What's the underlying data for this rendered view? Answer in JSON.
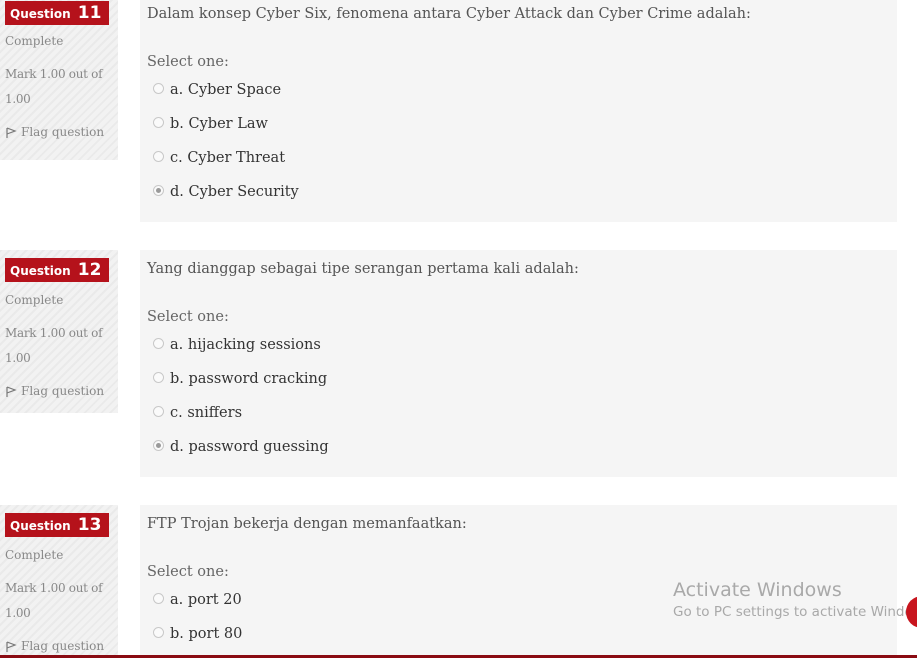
{
  "labels": {
    "question": "Question",
    "select_one": "Select one:"
  },
  "questions": [
    {
      "number": "11",
      "state": "Complete",
      "grade_line1": "Mark 1.00 out of",
      "grade_line2": "1.00",
      "flag": "Flag question",
      "text": "Dalam konsep Cyber Six, fenomena antara Cyber Attack dan Cyber Crime adalah:",
      "options": [
        {
          "label": "a. Cyber Space",
          "selected": false
        },
        {
          "label": "b. Cyber Law",
          "selected": false
        },
        {
          "label": "c. Cyber Threat",
          "selected": false
        },
        {
          "label": "d. Cyber Security",
          "selected": true
        }
      ]
    },
    {
      "number": "12",
      "state": "Complete",
      "grade_line1": "Mark 1.00 out of",
      "grade_line2": "1.00",
      "flag": "Flag question",
      "text": "Yang dianggap sebagai tipe serangan pertama kali adalah:",
      "options": [
        {
          "label": "a. hijacking sessions",
          "selected": false
        },
        {
          "label": "b. password cracking",
          "selected": false
        },
        {
          "label": "c. sniffers",
          "selected": false
        },
        {
          "label": "d. password guessing",
          "selected": true
        }
      ]
    },
    {
      "number": "13",
      "state": "Complete",
      "grade_line1": "Mark 1.00 out of",
      "grade_line2": "1.00",
      "flag": "Flag question",
      "text": "FTP Trojan bekerja dengan memanfaatkan:",
      "options": [
        {
          "label": "a. port 20",
          "selected": false
        },
        {
          "label": "b. port 80",
          "selected": false
        }
      ]
    }
  ],
  "watermark": {
    "title": "Activate Windows",
    "subtitle": "Go to PC settings to activate Windows."
  },
  "colors": {
    "accent": "#b5121b",
    "panel": "#f5f5f5",
    "info_bg": "#f2f2f2"
  }
}
